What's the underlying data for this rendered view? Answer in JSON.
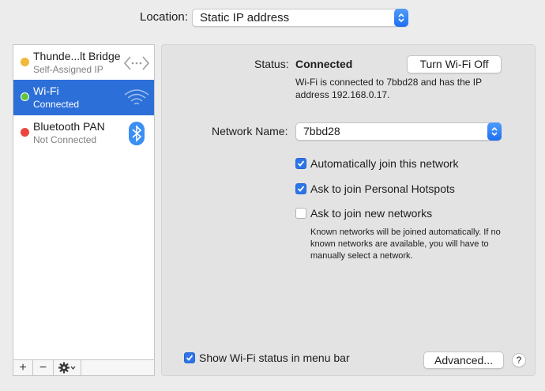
{
  "location": {
    "label": "Location:",
    "value": "Static IP address"
  },
  "services": [
    {
      "name": "Thunde...lt Bridge",
      "status": "Self-Assigned IP",
      "dot_color": "#f1b83a",
      "icon": "thunderbolt-bridge-icon"
    },
    {
      "name": "Wi-Fi",
      "status": "Connected",
      "dot_color": "#5fc43e",
      "icon": "wifi-icon"
    },
    {
      "name": "Bluetooth PAN",
      "status": "Not Connected",
      "dot_color": "#e9463f",
      "icon": "bluetooth-icon"
    }
  ],
  "toolbar": {
    "add": "+",
    "remove": "−"
  },
  "panel": {
    "status_label": "Status:",
    "status_value": "Connected",
    "turn_off_button": "Turn Wi-Fi Off",
    "status_description": "Wi-Fi is connected to 7bbd28 and has the IP address 192.168.0.17.",
    "network_name_label": "Network Name:",
    "network_name_value": "7bbd28",
    "options": [
      {
        "label": "Automatically join this network",
        "checked": true
      },
      {
        "label": "Ask to join Personal Hotspots",
        "checked": true
      },
      {
        "label": "Ask to join new networks",
        "checked": false
      }
    ],
    "new_networks_note": "Known networks will be joined automatically. If no known networks are available, you will have to manually select a network.",
    "show_status_label": "Show Wi-Fi status in menu bar",
    "show_status_checked": true,
    "advanced_button": "Advanced...",
    "help_button": "?"
  },
  "colors": {
    "accent": "#2d6fd8",
    "checkbox": "#2d74e8"
  }
}
